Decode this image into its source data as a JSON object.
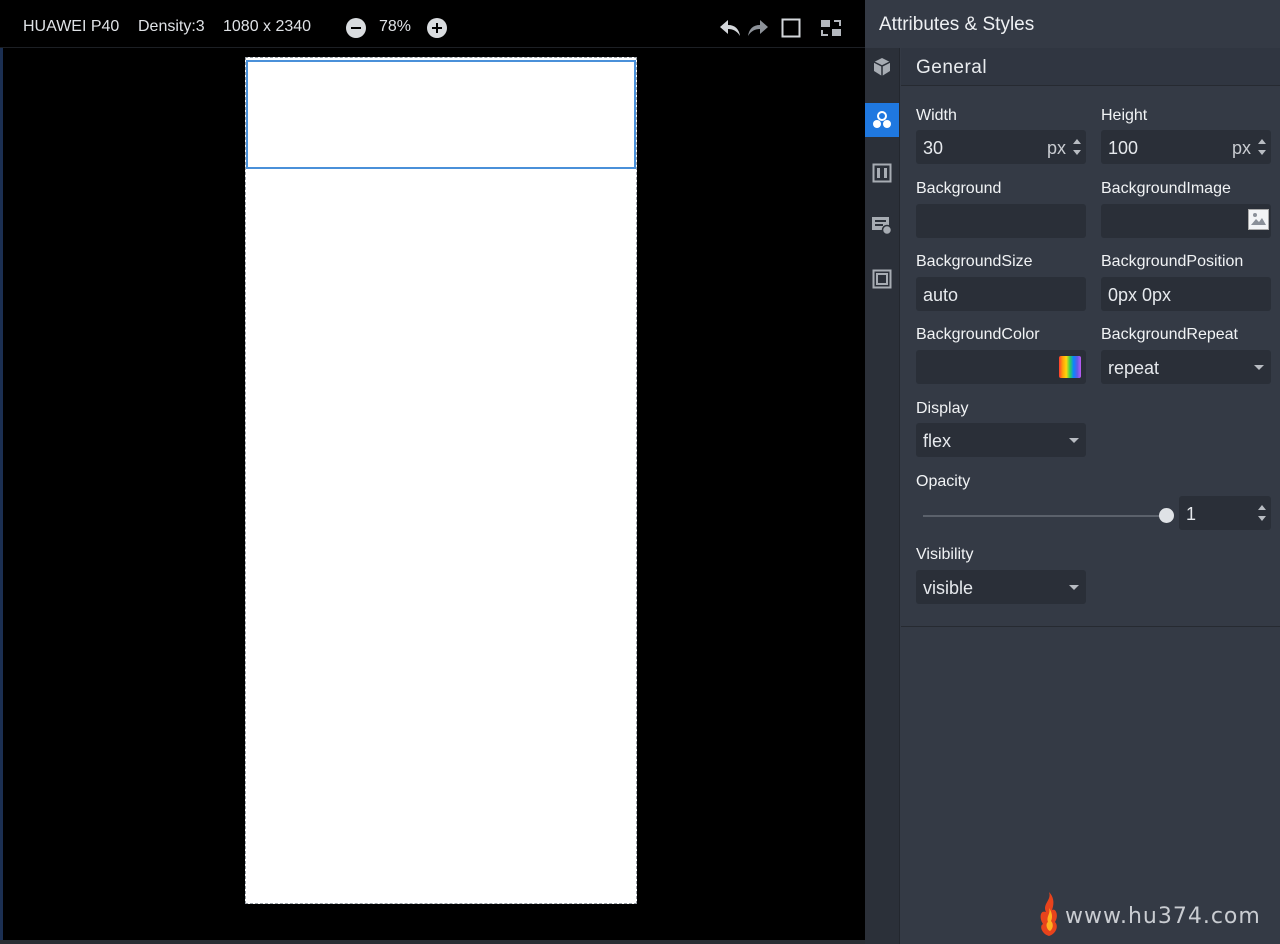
{
  "device_toolbar": {
    "device_name": "HUAWEI P40",
    "density": "Density:3",
    "resolution": "1080 x 2340",
    "zoom": "78%",
    "icons": [
      "zoom-out-icon",
      "zoom-in-icon",
      "undo-icon",
      "redo-icon",
      "frame-icon",
      "layout-switch-icon"
    ]
  },
  "panel": {
    "title": "Attributes & Styles",
    "tabs": [
      "cube-icon",
      "styles-icon",
      "columns-icon",
      "event-icon",
      "border-icon"
    ],
    "active_tab": "styles-icon",
    "section": "General",
    "fields": {
      "width": {
        "label": "Width",
        "value": "30",
        "unit": "px"
      },
      "height": {
        "label": "Height",
        "value": "100",
        "unit": "px"
      },
      "background": {
        "label": "Background",
        "value": ""
      },
      "background_image": {
        "label": "BackgroundImage",
        "value": ""
      },
      "background_size": {
        "label": "BackgroundSize",
        "value": "auto"
      },
      "background_position": {
        "label": "BackgroundPosition",
        "value": "0px 0px"
      },
      "background_color": {
        "label": "BackgroundColor",
        "value": ""
      },
      "background_repeat": {
        "label": "BackgroundRepeat",
        "value": "repeat"
      },
      "display": {
        "label": "Display",
        "value": "flex"
      },
      "opacity": {
        "label": "Opacity",
        "value": "1",
        "slider_fraction": 1.0
      },
      "visibility": {
        "label": "Visibility",
        "value": "visible"
      }
    }
  },
  "watermark": {
    "text": "www.hu374.com"
  },
  "colors": {
    "accent": "#1f78e0",
    "panel_bg": "#343a45",
    "field_bg": "#2a2f38",
    "selection": "#4a90d9"
  }
}
